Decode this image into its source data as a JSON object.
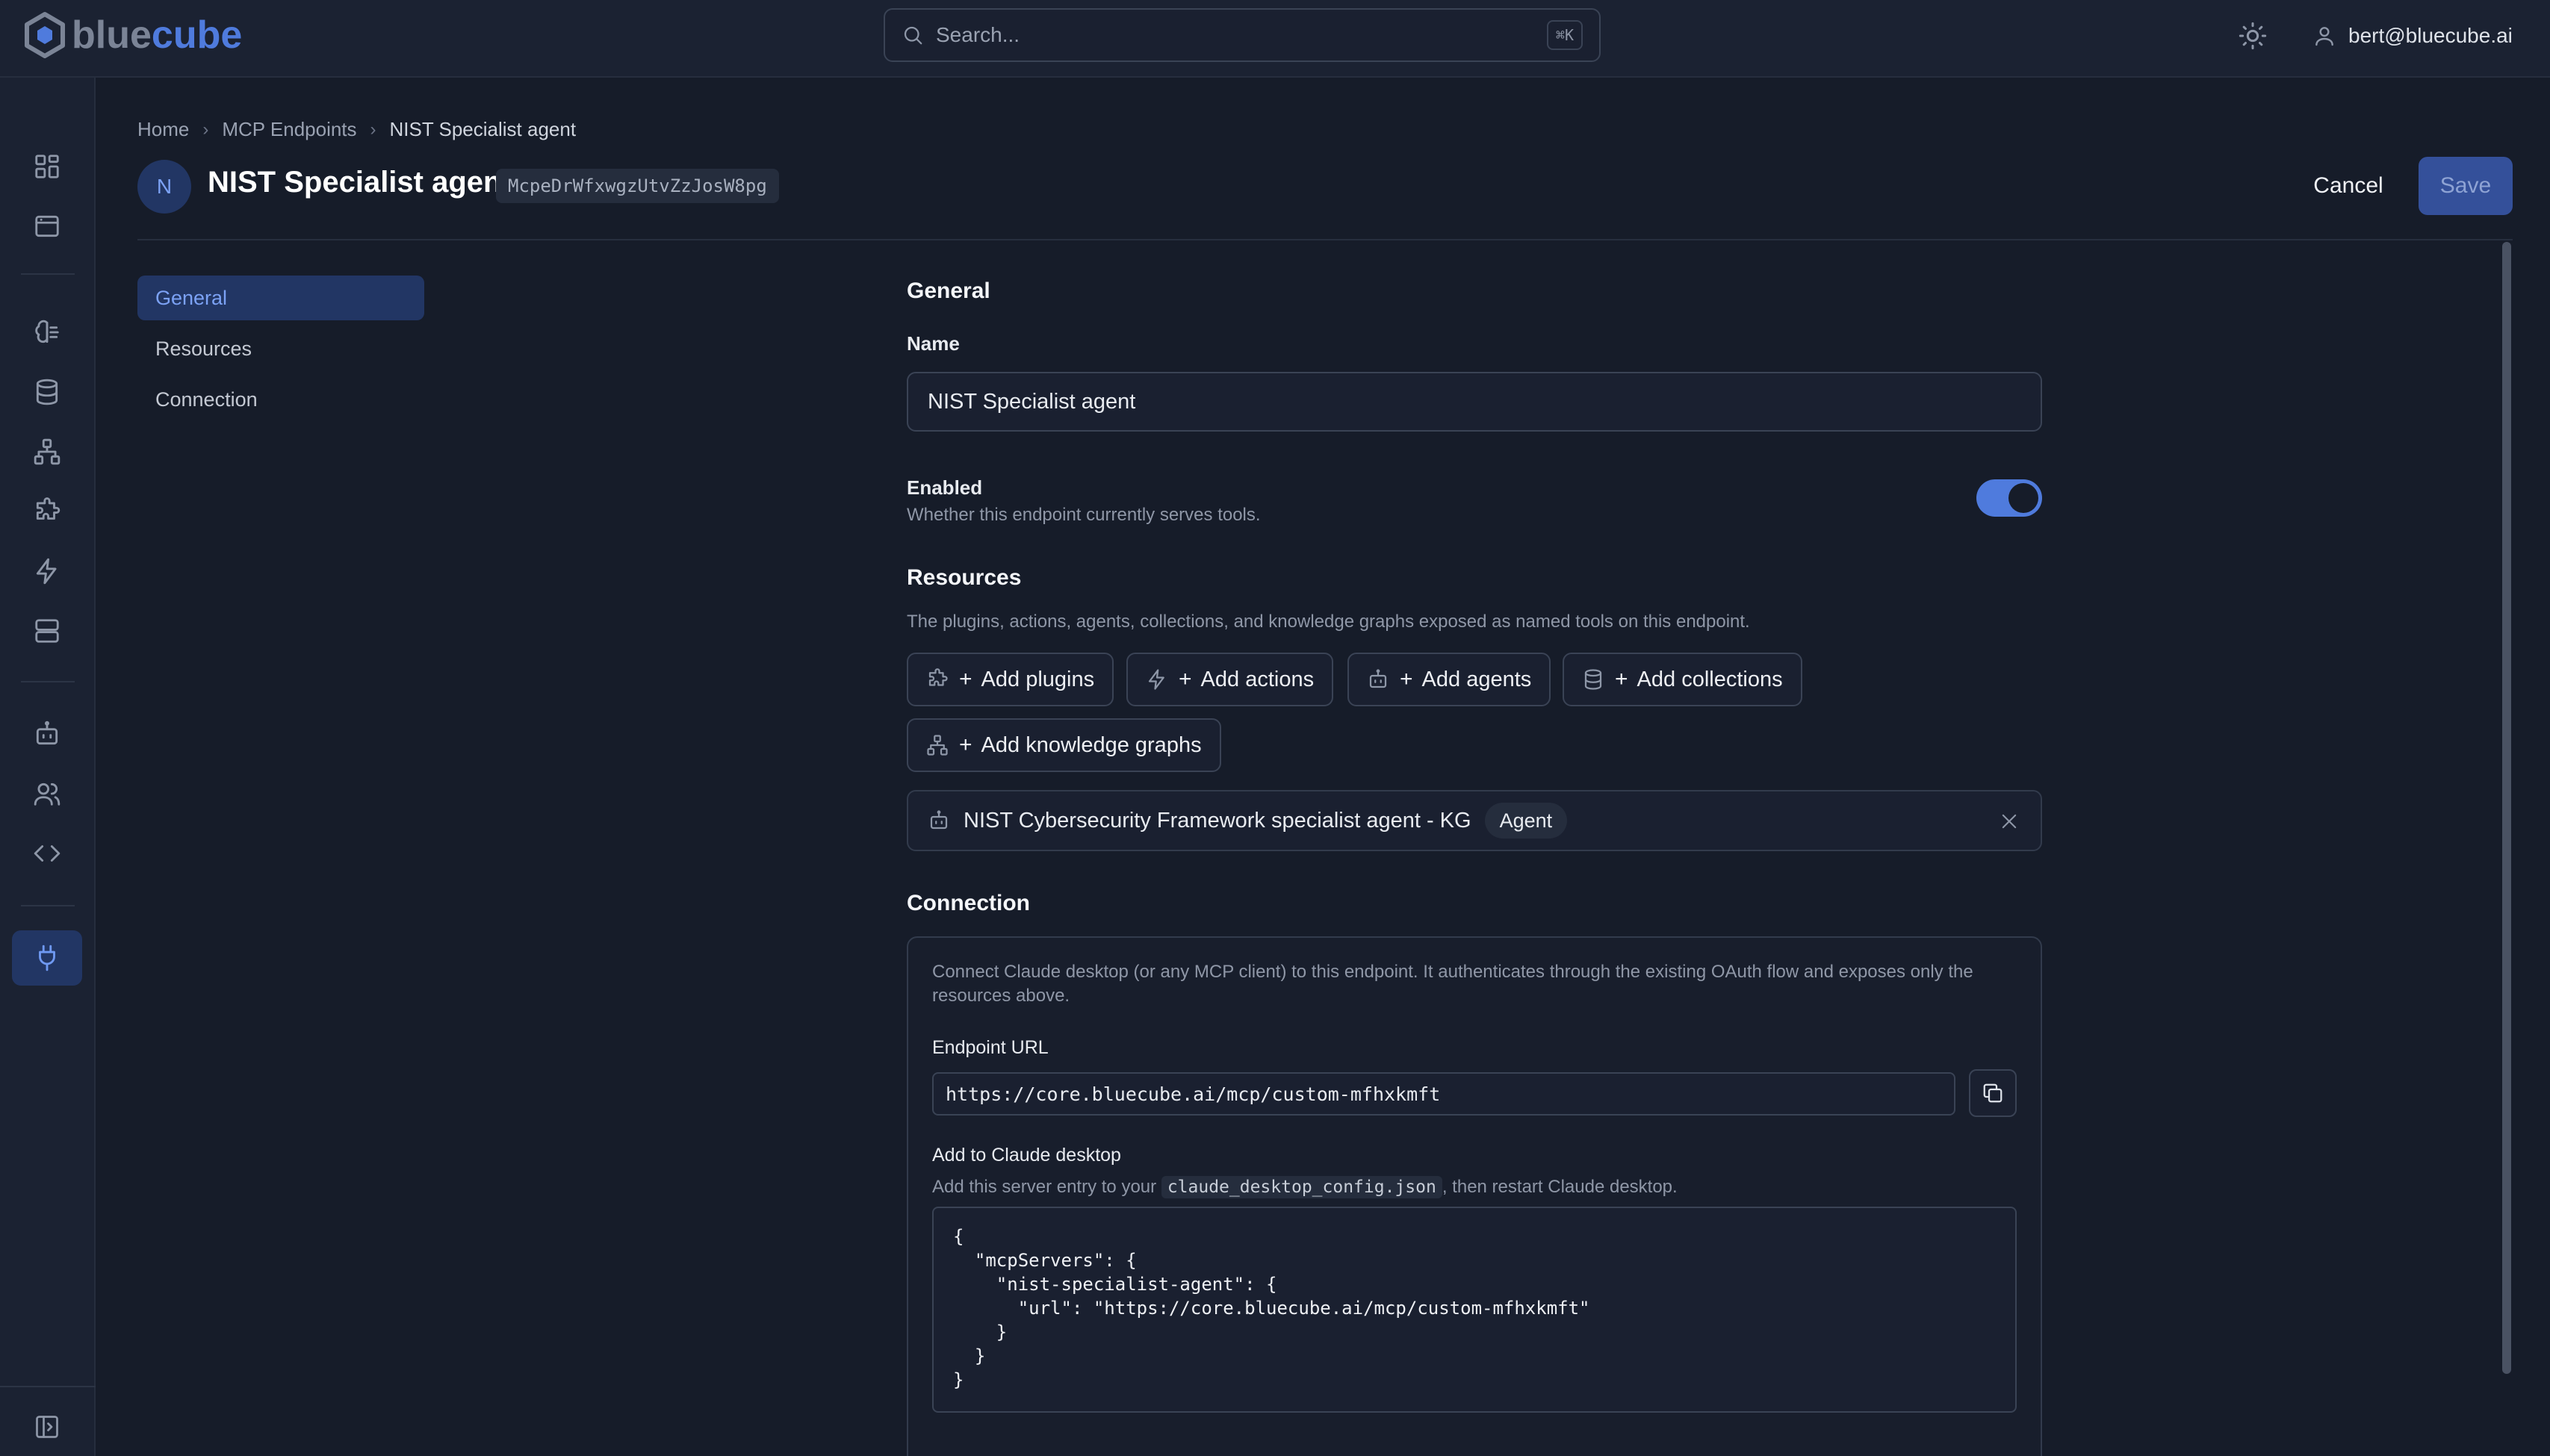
{
  "app": {
    "logo_prefix": "blue",
    "logo_suffix": "cube"
  },
  "topbar": {
    "search_placeholder": "Search...",
    "search_shortcut": "⌘K",
    "user_email": "bert@bluecube.ai"
  },
  "breadcrumb": {
    "items": [
      "Home",
      "MCP Endpoints",
      "NIST Specialist agent"
    ],
    "separator": "›"
  },
  "header": {
    "avatar_letter": "N",
    "title": "NIST Specialist agent",
    "endpoint_id": "McpeDrWfxwgzUtvZzJosW8pg",
    "cancel_label": "Cancel",
    "save_label": "Save"
  },
  "sidenav": {
    "items": [
      "General",
      "Resources",
      "Connection"
    ],
    "active": "General"
  },
  "general": {
    "heading": "General",
    "name_label": "Name",
    "name_value": "NIST Specialist agent",
    "enabled_label": "Enabled",
    "enabled_help": "Whether this endpoint currently serves tools.",
    "enabled": true
  },
  "resources": {
    "heading": "Resources",
    "description": "The plugins, actions, agents, collections, and knowledge graphs exposed as named tools on this endpoint.",
    "add_buttons": {
      "plugins": "Add plugins",
      "actions": "Add actions",
      "agents": "Add agents",
      "collections": "Add collections",
      "knowledge_graphs": "Add knowledge graphs"
    },
    "plus": "+",
    "items": [
      {
        "name": "NIST Cybersecurity Framework specialist agent - KG",
        "type": "Agent",
        "icon": "robot-icon"
      }
    ]
  },
  "connection": {
    "heading": "Connection",
    "description": "Connect Claude desktop (or any MCP client) to this endpoint. It authenticates through the existing OAuth flow and exposes only the resources above.",
    "endpoint_url_label": "Endpoint URL",
    "endpoint_url": "https://core.bluecube.ai/mcp/custom-mfhxkmft",
    "claude_label": "Add to Claude desktop",
    "claude_help_before": "Add this server entry to your",
    "claude_help_file": "claude_desktop_config.json",
    "claude_help_after": ", then restart Claude desktop.",
    "config_json": "{\n  \"mcpServers\": {\n    \"nist-specialist-agent\": {\n      \"url\": \"https://core.bluecube.ai/mcp/custom-mfhxkmft\"\n    }\n  }\n}"
  },
  "colors": {
    "accent": "#4f7bdd",
    "background": "#161c29",
    "panel": "#1b2232"
  }
}
